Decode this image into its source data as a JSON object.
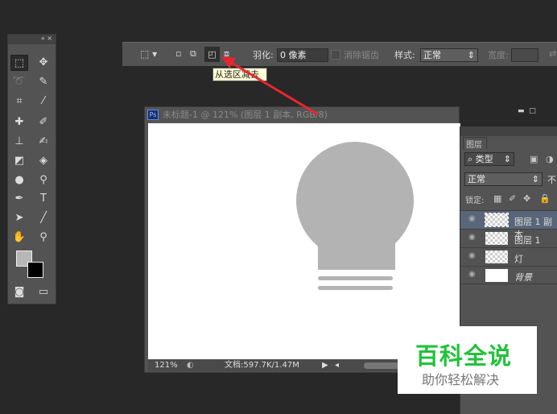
{
  "toolbox": {
    "collapse": "«",
    "close": "×",
    "text_tool": "T"
  },
  "options": {
    "feather_label": "羽化:",
    "feather_value": "0 像素",
    "antialias_label": "消除锯齿",
    "style_label": "样式:",
    "style_value": "正常",
    "width_label": "宽度:"
  },
  "tooltip": "从选区减去",
  "document": {
    "title": "未标题-1 @ 121% (图层 1 副本, RGB/8)",
    "ps_badge": "Ps",
    "zoom": "121%",
    "doc_info": "文档:597.7K/1.47M"
  },
  "layers": {
    "tab": "图层",
    "filter_kind": "类型",
    "blend_mode": "正常",
    "opacity_label": "不",
    "lock_label": "锁定:",
    "items": [
      {
        "name": "图层 1 副本",
        "selected": true
      },
      {
        "name": "图层 1"
      },
      {
        "name": "灯"
      },
      {
        "name": "背景",
        "italic": true
      }
    ]
  },
  "watermark": {
    "title": "百科全说",
    "subtitle": "助你轻松解决"
  },
  "colors": {
    "accent_red": "#e8262f",
    "watermark_green": "#21c23a"
  }
}
